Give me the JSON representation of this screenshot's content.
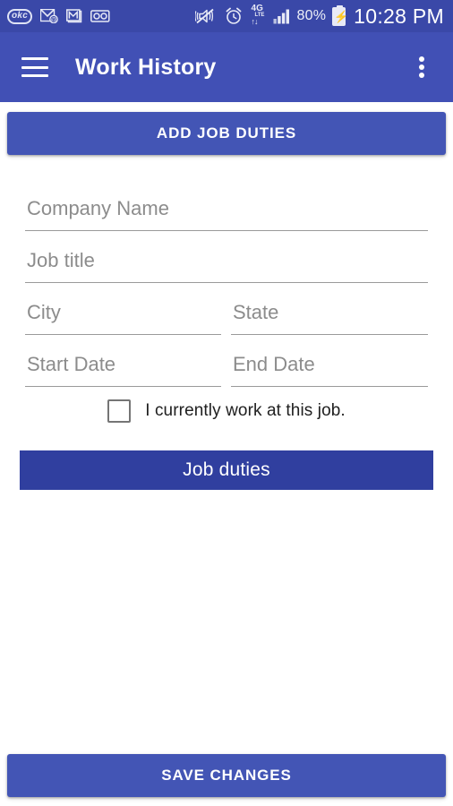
{
  "status_bar": {
    "background_color": "#3a48a8",
    "left_icons": [
      {
        "name": "okcupid-icon",
        "label": "okc"
      },
      {
        "name": "email-at-icon",
        "label": ""
      },
      {
        "name": "gmail-icon",
        "label": "M"
      },
      {
        "name": "voicemail-icon",
        "label": ""
      }
    ],
    "right_icons": [
      {
        "name": "vibrate-mute-icon",
        "label": ""
      },
      {
        "name": "alarm-clock-icon",
        "label": ""
      }
    ],
    "network": {
      "type": "4G",
      "sub": "LTE",
      "arrows": "↑↓"
    },
    "signal": {
      "name": "signal-bars-icon",
      "bars": 4,
      "total": 4
    },
    "battery_percent": "80%",
    "battery_charging": true,
    "time": "10:28 PM"
  },
  "app_bar": {
    "background_color": "#4150b5",
    "menu_icon": "hamburger-menu-icon",
    "title": "Work History",
    "overflow_icon": "overflow-menu-icon"
  },
  "main": {
    "add_job_duties_label": "ADD JOB DUTIES",
    "job_duties_label": "Job duties",
    "save_changes_label": "SAVE CHANGES",
    "accent_color": "#4355b5",
    "dark_accent_color": "#303f9f",
    "fields": {
      "company_name": {
        "placeholder": "Company Name",
        "value": ""
      },
      "job_title": {
        "placeholder": "Job title",
        "value": ""
      },
      "city": {
        "placeholder": "City",
        "value": ""
      },
      "state": {
        "placeholder": "State",
        "value": ""
      },
      "start_date": {
        "placeholder": "Start Date",
        "value": ""
      },
      "end_date": {
        "placeholder": "End Date",
        "value": ""
      }
    },
    "checkbox": {
      "label": "I currently work at this job.",
      "checked": false
    }
  }
}
